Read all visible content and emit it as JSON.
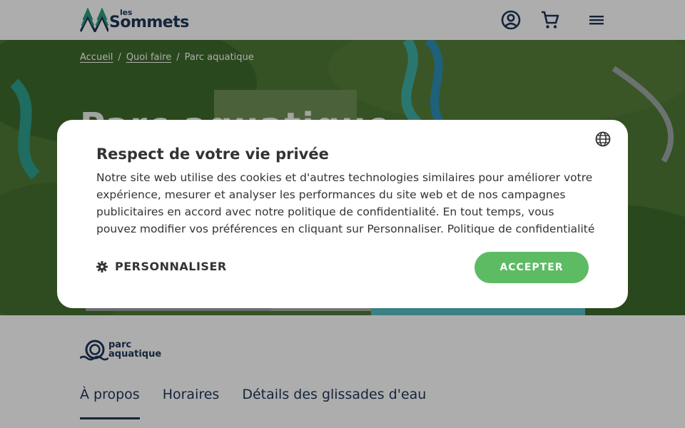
{
  "colors": {
    "brand_navy": "#1e3557",
    "accept_green": "#5dbb63",
    "modal_bg": "#ffffff",
    "overlay": "rgba(0,0,0,0.32)"
  },
  "header": {
    "logo": {
      "top": "les",
      "main": "Sommets"
    },
    "icons": [
      "account-circle-icon",
      "cart-icon",
      "hamburger-menu-icon"
    ]
  },
  "breadcrumb": {
    "items": [
      "Accueil",
      "Quoi faire",
      "Parc aquatique"
    ]
  },
  "hero": {
    "image": "aerial view of water park with green slides and forest",
    "title": "Parc aquatique"
  },
  "section": {
    "logo": {
      "line1": "parc",
      "line2": "aquatique"
    },
    "tabs": [
      "À propos",
      "Horaires",
      "Détails des glissades d'eau"
    ],
    "active_tab": "À propos"
  },
  "cookie_modal": {
    "title": "Respect de votre vie privée",
    "body": "Notre site web utilise des cookies et d'autres technologies similaires pour améliorer votre expérience, mesurer et analyser les performances du site web et de nos campagnes publicitaires en accord avec notre politique de confidentialité. En tout temps, vous pouvez modifier vos préférences en cliquant sur Personnaliser. Politique de confidentialité",
    "customize_label": "PERSONNALISER",
    "accept_label": "ACCEPTER",
    "language_icon": "globe-icon"
  }
}
